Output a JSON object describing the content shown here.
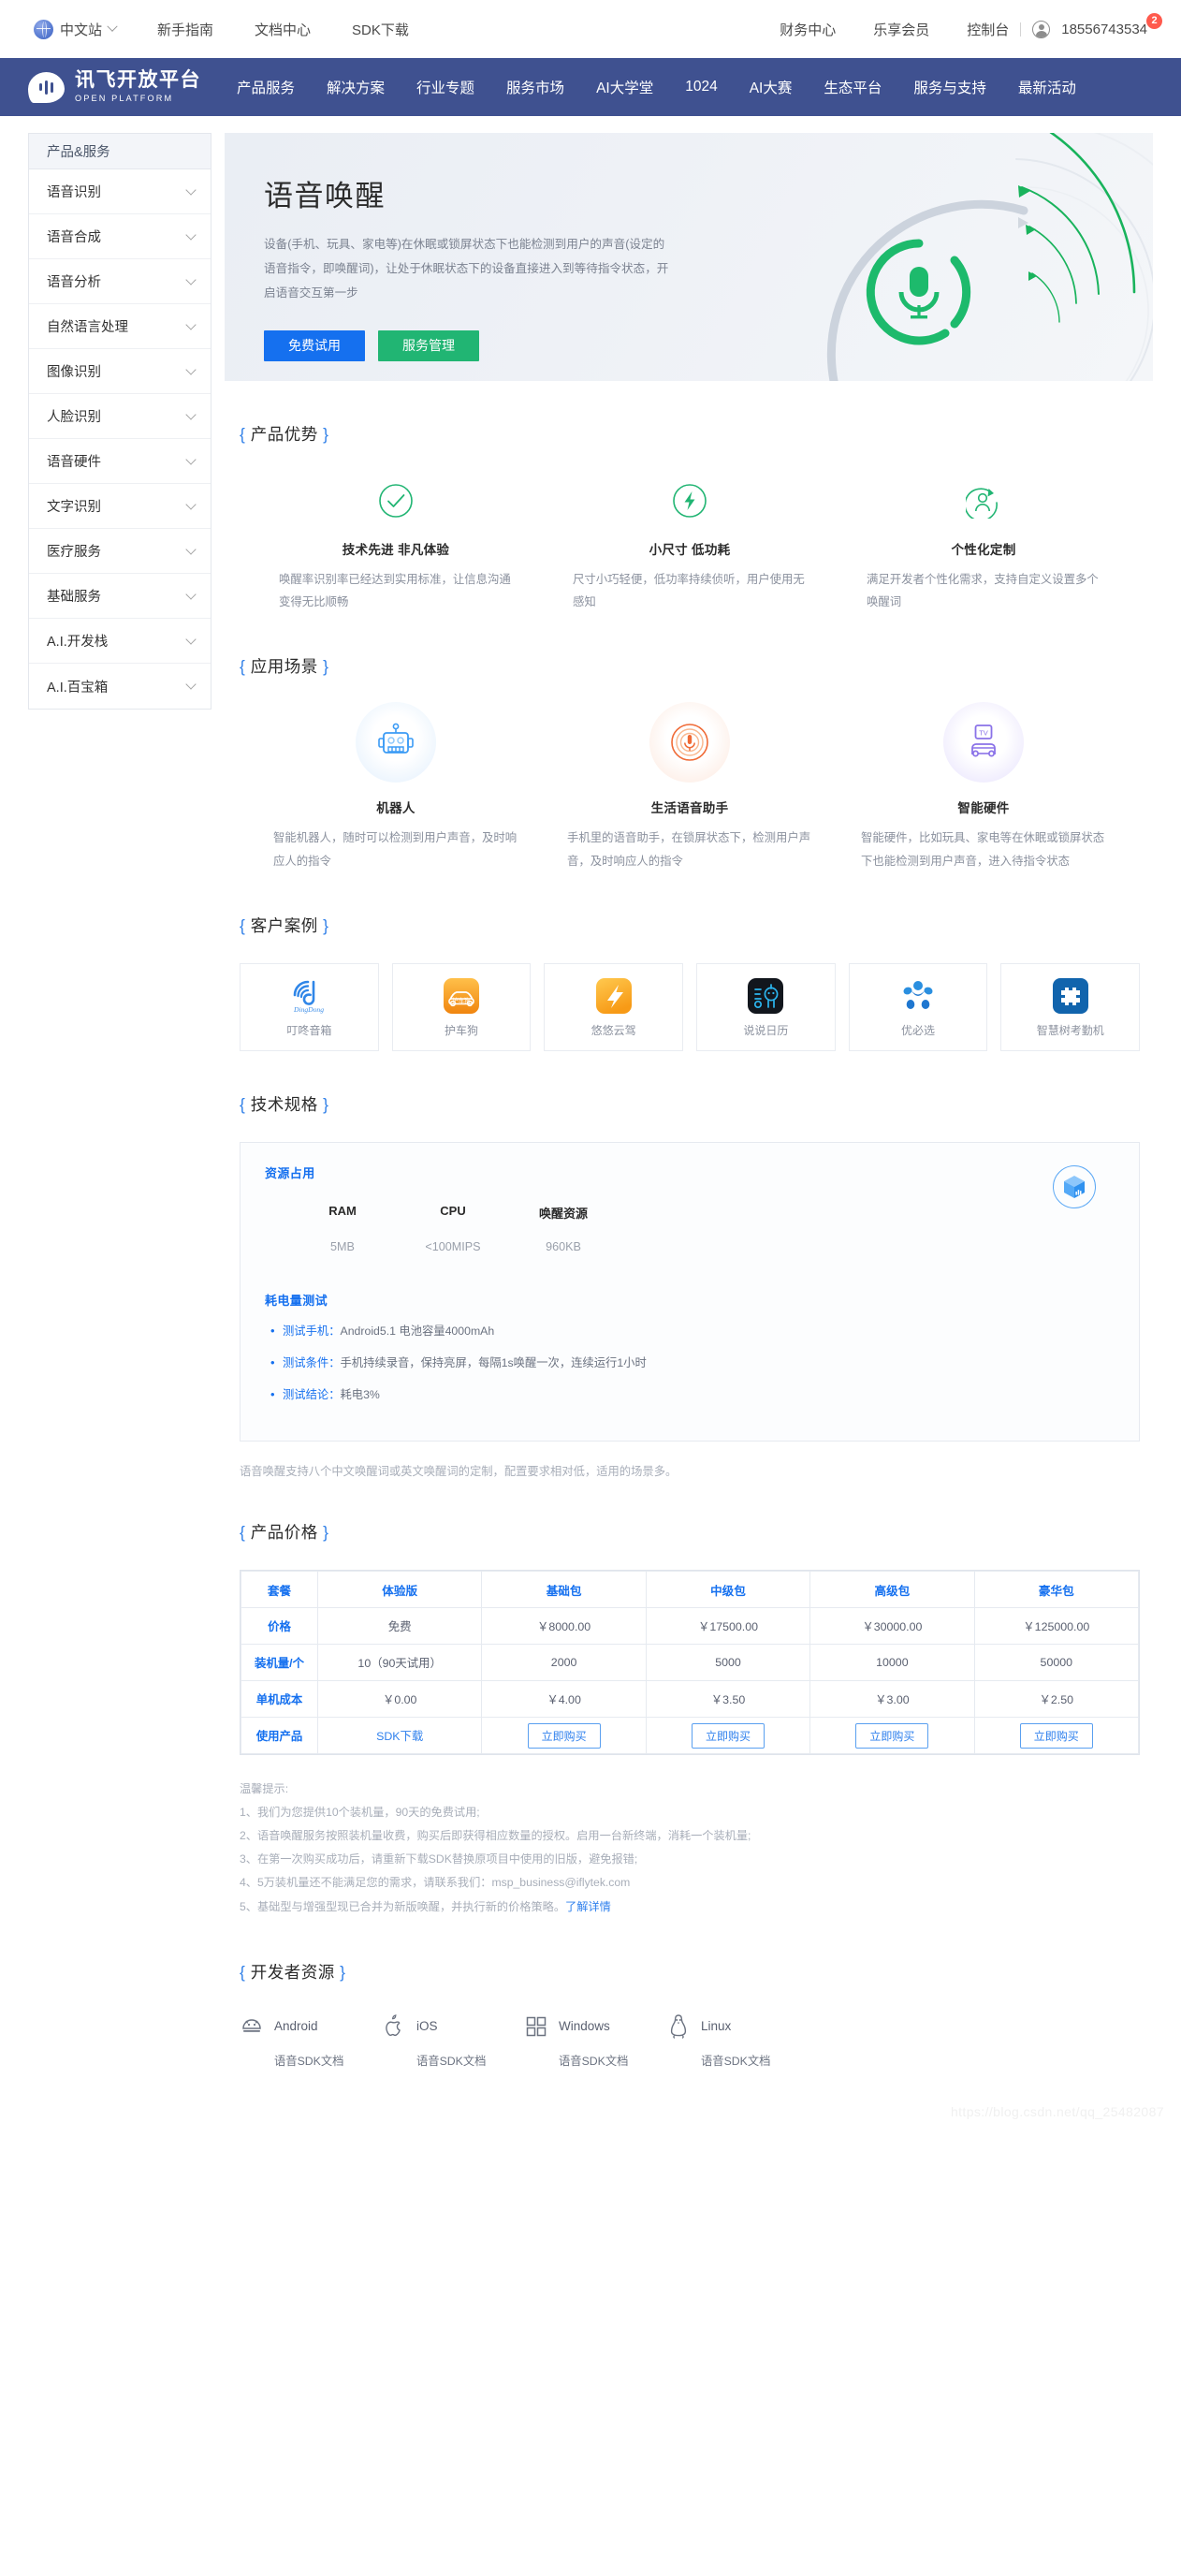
{
  "topbar": {
    "locale": "中文站",
    "links": [
      "新手指南",
      "文档中心",
      "SDK下载"
    ],
    "right_links": [
      "财务中心",
      "乐享会员"
    ],
    "console": "控制台",
    "account": "18556743534",
    "badge": "2"
  },
  "nav": {
    "brand_cn": "讯飞开放平台",
    "brand_en": "OPEN PLATFORM",
    "links": [
      "产品服务",
      "解决方案",
      "行业专题",
      "服务市场",
      "AI大学堂",
      "1024",
      "AI大赛",
      "生态平台",
      "服务与支持",
      "最新活动"
    ]
  },
  "sidebar": {
    "title": "产品&服务",
    "items": [
      "语音识别",
      "语音合成",
      "语音分析",
      "自然语言处理",
      "图像识别",
      "人脸识别",
      "语音硬件",
      "文字识别",
      "医疗服务",
      "基础服务",
      "A.I.开发栈",
      "A.I.百宝箱"
    ]
  },
  "hero": {
    "title": "语音唤醒",
    "desc": "设备(手机、玩具、家电等)在休眠或锁屏状态下也能检测到用户的声音(设定的语音指令，即唤醒词)，让处于休眠状态下的设备直接进入到等待指令状态，开启语音交互第一步",
    "btn_trial": "免费试用",
    "btn_manage": "服务管理"
  },
  "advantages": {
    "title": "产品优势",
    "items": [
      {
        "icon": "check-circle-icon",
        "name": "技术先进 非凡体验",
        "desc": "唤醒率识别率已经达到实用标准，让信息沟通变得无比顺畅"
      },
      {
        "icon": "lightning-circle-icon",
        "name": "小尺寸 低功耗",
        "desc": "尺寸小巧轻便，低功率持续侦听，用户使用无感知"
      },
      {
        "icon": "person-refresh-circle-icon",
        "name": "个性化定制",
        "desc": "满足开发者个性化需求，支持自定义设置多个唤醒词"
      }
    ]
  },
  "scenarios": {
    "title": "应用场景",
    "items": [
      {
        "icon": "robot-icon",
        "color": "blue",
        "name": "机器人",
        "desc": "智能机器人，随时可以检测到用户声音，及时响应人的指令"
      },
      {
        "icon": "mic-ripple-icon",
        "color": "orange",
        "name": "生活语音助手",
        "desc": "手机里的语音助手，在锁屏状态下，检测用户声音，及时响应人的指令"
      },
      {
        "icon": "tv-car-icon",
        "color": "purple",
        "name": "智能硬件",
        "desc": "智能硬件，比如玩具、家电等在休眠或锁屏状态下也能检测到用户声音，进入待指令状态"
      }
    ]
  },
  "cases": {
    "title": "客户案例",
    "items": [
      {
        "logo": "dingdong-logo",
        "name": "叮咚音箱"
      },
      {
        "logo": "huchegou-logo",
        "name": "护车狗"
      },
      {
        "logo": "youyouyunjia-logo",
        "name": "悠悠云驾"
      },
      {
        "logo": "shuoshuorili-logo",
        "name": "说说日历"
      },
      {
        "logo": "ubtech-logo",
        "name": "优必选"
      },
      {
        "logo": "zhihuishu-logo",
        "name": "智慧树考勤机"
      }
    ]
  },
  "spec": {
    "title": "技术规格",
    "resource_heading": "资源占用",
    "columns": [
      "RAM",
      "CPU",
      "唤醒资源"
    ],
    "values": [
      "5MB",
      "<100MIPS",
      "960KB"
    ],
    "power_heading": "耗电量测试",
    "bullets": [
      {
        "key": "测试手机：",
        "val": "Android5.1 电池容量4000mAh"
      },
      {
        "key": "测试条件：",
        "val": "手机持续录音，保持亮屏，每隔1s唤醒一次，连续运行1小时"
      },
      {
        "key": "测试结论：",
        "val": "耗电3%"
      }
    ],
    "footnote": "语音唤醒支持八个中文唤醒词或英文唤醒词的定制，配置要求相对低，适用的场景多。"
  },
  "pricing": {
    "title": "产品价格",
    "header": [
      "套餐",
      "体验版",
      "基础包",
      "中级包",
      "高级包",
      "豪华包"
    ],
    "rows": [
      {
        "label": "价格",
        "cells": [
          "免费",
          "￥8000.00",
          "￥17500.00",
          "￥30000.00",
          "￥125000.00"
        ]
      },
      {
        "label": "装机量/个",
        "cells": [
          "10（90天试用）",
          "2000",
          "5000",
          "10000",
          "50000"
        ]
      },
      {
        "label": "单机成本",
        "cells": [
          "￥0.00",
          "￥4.00",
          "￥3.50",
          "￥3.00",
          "￥2.50"
        ]
      }
    ],
    "action_row_label": "使用产品",
    "sdk_label": "SDK下载",
    "buy_label": "立即购买"
  },
  "tips": {
    "heading": "温馨提示:",
    "lines": [
      "1、我们为您提供10个装机量，90天的免费试用;",
      "2、语音唤醒服务按照装机量收费，购买后即获得相应数量的授权。启用一台新终端，消耗一个装机量;",
      "3、在第一次购买成功后，请重新下载SDK替换原项目中使用的旧版，避免报错;",
      "4、5万装机量还不能满足您的需求，请联系我们：msp_business@iflytek.com"
    ],
    "line5_prefix": "5、基础型与增强型现已合并为新版唤醒，并执行新的价格策略。",
    "line5_link": "了解详情"
  },
  "dev": {
    "title": "开发者资源",
    "items": [
      {
        "icon": "android-icon",
        "os": "Android",
        "doc": "语音SDK文档"
      },
      {
        "icon": "apple-icon",
        "os": "iOS",
        "doc": "语音SDK文档"
      },
      {
        "icon": "windows-icon",
        "os": "Windows",
        "doc": "语音SDK文档"
      },
      {
        "icon": "linux-penguin-icon",
        "os": "Linux",
        "doc": "语音SDK文档"
      }
    ]
  },
  "watermark": "https://blog.csdn.net/qq_25482087",
  "colors": {
    "nav_bg": "#3f5190",
    "primary": "#1570ef",
    "success": "#21b573",
    "link": "#2f80ed"
  }
}
